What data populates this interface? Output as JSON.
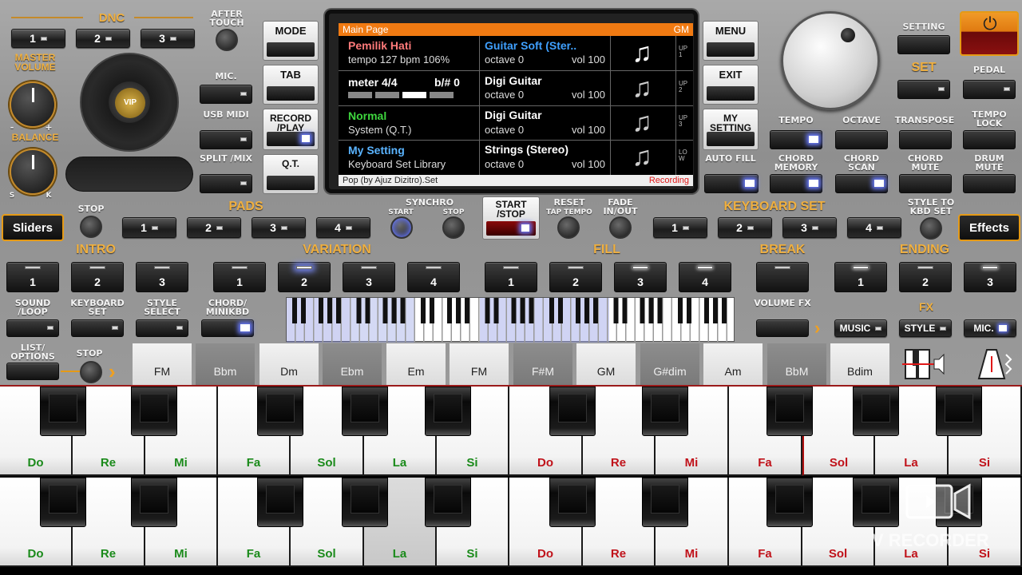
{
  "dnc": {
    "title": "DNC",
    "buttons": [
      "1",
      "2",
      "3"
    ]
  },
  "after_touch": "AFTER TOUCH",
  "master_volume": "MASTER VOLUME",
  "balance": {
    "label": "BALANCE",
    "minus": "-",
    "plus": "+",
    "s": "S",
    "k": "K"
  },
  "vip_badge": "VIP",
  "left_col": {
    "mic": "MIC.",
    "usb_midi": "USB MIDI",
    "split_mix": "SPLIT /MIX"
  },
  "mid_col": {
    "mode": "MODE",
    "tab": "TAB",
    "record_play": "RECORD /PLAY",
    "qt": "Q.T."
  },
  "right_col": {
    "menu": "MENU",
    "exit": "EXIT",
    "my_setting": "MY SETTING",
    "auto_fill": "AUTO FILL"
  },
  "screen": {
    "header_left": "Main Page",
    "header_right": "GM",
    "rows": [
      {
        "left_title": "Pemilik Hati",
        "left_sub": "tempo 127 bpm 106%",
        "right_title": "Guitar Soft (Ster..",
        "right_sub": "octave  0",
        "right_vol": "vol 100"
      },
      {
        "left_title": "meter 4/4",
        "left_extra": "b/#  0",
        "right_title": "Digi Guitar",
        "right_sub": "octave  0",
        "right_vol": "vol 100"
      },
      {
        "left_title": "Normal",
        "left_sub": "System (Q.T.)",
        "right_title": "Digi Guitar",
        "right_sub": "octave  0",
        "right_vol": "vol 100"
      },
      {
        "left_title": "My Setting",
        "left_sub": "Keyboard Set Library",
        "right_title": "Strings (Stereo)",
        "right_sub": "octave  0",
        "right_vol": "vol 100"
      }
    ],
    "side_labels": [
      "UP1",
      "UP2",
      "UP3",
      "LOW"
    ],
    "footer_left": "Pop (by Ajuz Dizitro).Set",
    "footer_right": "Recording"
  },
  "top_right": {
    "setting": "SETTING",
    "set": "SET",
    "pedal": "PEDAL",
    "tempo": "TEMPO",
    "octave": "OCTAVE",
    "transpose": "TRANSPOSE",
    "tempo_lock": "TEMPO LOCK",
    "chord_memory": "CHORD MEMORY",
    "chord_scan": "CHORD SCAN",
    "chord_mute": "CHORD MUTE",
    "drum_mute": "DRUM MUTE"
  },
  "row_pads": {
    "sliders": "Sliders",
    "stop": "STOP",
    "pads": "PADS",
    "pad_buttons": [
      "1",
      "2",
      "3",
      "4"
    ],
    "synchro": "SYNCHRO",
    "start": "START",
    "stop2": "STOP",
    "start_stop": "START /STOP",
    "reset": "RESET",
    "tap_tempo": "TAP TEMPO",
    "fade": "FADE IN/OUT",
    "keyboard_set": "KEYBOARD SET",
    "kbd_buttons": [
      "1",
      "2",
      "3",
      "4"
    ],
    "style_to_kbd": "STYLE TO KBD SET",
    "effects": "Effects"
  },
  "row_sections": {
    "intro": "INTRO",
    "intro_buttons": [
      "1",
      "2",
      "3"
    ],
    "variation": "VARIATION",
    "variation_buttons": [
      "1",
      "2",
      "3",
      "4"
    ],
    "fill": "FILL",
    "fill_buttons": [
      "1",
      "2",
      "3",
      "4"
    ],
    "break": "BREAK",
    "ending": "ENDING",
    "ending_buttons": [
      "1",
      "2",
      "3"
    ]
  },
  "row_lower": {
    "sound_loop": "SOUND /LOOP",
    "keyboard_set": "KEYBOARD SET",
    "style_select": "STYLE SELECT",
    "chord_minikbd": "CHORD/ MINIKBD",
    "volume_fx": "VOLUME FX",
    "fx": "FX",
    "music": "MUSIC",
    "style": "STYLE",
    "mic": "MIC."
  },
  "list_options": "LIST/ OPTIONS",
  "stop_small": "STOP",
  "chords": [
    "FM",
    "Bbm",
    "Dm",
    "Ebm",
    "Em",
    "FM",
    "F#M",
    "GM",
    "G#dim",
    "Am",
    "BbM",
    "Bdim"
  ],
  "keyboard_top": {
    "labels": [
      "Do",
      "Re",
      "Mi",
      "Fa",
      "Sol",
      "La",
      "Si",
      "Do",
      "Re",
      "Mi",
      "Fa",
      "Sol",
      "La",
      "Si"
    ],
    "colors": [
      "#1a8a1a",
      "#1a8a1a",
      "#1a8a1a",
      "#1a8a1a",
      "#1a8a1a",
      "#1a8a1a",
      "#1a8a1a",
      "#c0121a",
      "#c0121a",
      "#c0121a",
      "#c0121a",
      "#c0121a",
      "#c0121a",
      "#c0121a"
    ]
  },
  "keyboard_bottom": {
    "labels": [
      "Do",
      "Re",
      "Mi",
      "Fa",
      "Sol",
      "La",
      "Si",
      "Do",
      "Re",
      "Mi",
      "Fa",
      "Sol",
      "La",
      "Si"
    ]
  },
  "watermark": "V RECORDER",
  "colors": {
    "accent_orange": "#f0b040",
    "screen_header": "#f07a12",
    "led_blue": "#6a7cff"
  }
}
